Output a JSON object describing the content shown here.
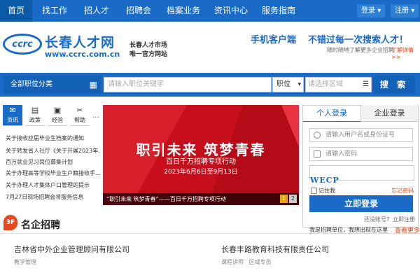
{
  "nav": {
    "items": [
      "首页",
      "找工作",
      "招人才",
      "招聘会",
      "档案业务",
      "资讯中心",
      "服务指南"
    ],
    "login": "登录",
    "register": "注册"
  },
  "header": {
    "logo_badge": "ccrc",
    "logo_name": "长春人才网",
    "logo_url": "www.ccrc.com.cn",
    "side_line1": "长春人才市场",
    "side_line2": "唯一官方网站",
    "slogan_mobile": "手机客户端",
    "slogan_main": "不错过每一次搜索人才！",
    "slogan_sub": "随时随地了解更多企业招聘",
    "learn_more": "了解详情>>"
  },
  "search": {
    "category_label": "全部职位分类",
    "placeholder": "请输入职位关键字",
    "type_selected": "职位",
    "region_placeholder": "请选择区域",
    "button_label": "搜 索"
  },
  "info_tabs": [
    "资讯",
    "政策",
    "经验",
    "帮助"
  ],
  "news": [
    "关于接收应届毕业生档案的通知",
    "关于转发省人社厅《关于开展2023年...",
    "百万就业见习岗位募集计划",
    "关于办理高等学校毕业生户籍接收手...",
    "关于办理人才集体户口管理的提示",
    "7月27日现场招聘会将服务信息"
  ],
  "banner": {
    "title": "职引未来 筑梦青春",
    "subtitle": "百日千万招聘专项行动",
    "date_range": "2023年6月6日至9月13日",
    "caption": "“职引未来 筑梦青春”——百日千万招聘专项行动",
    "pages": [
      "1",
      "2"
    ]
  },
  "login": {
    "tab_personal": "个人登录",
    "tab_company": "企业登录",
    "username_placeholder": "请输入用户名或身份证号",
    "password_placeholder": "请输入密码",
    "captcha": "WECP",
    "remember": "记住我",
    "forgot": "忘记密码",
    "submit": "立即登录",
    "no_account": "还没账号?",
    "register_now": "立即注册",
    "employer_tip": "我是招聘单位，我想出现在这里",
    "more": "查看更多"
  },
  "featured": {
    "badge": "3F",
    "title": "名企招聘",
    "companies": [
      {
        "name": "吉林省中外企业管理顾问有限公司",
        "jobs": "教学管理"
      },
      {
        "name": "长春丰路教育科技有限责任公司",
        "jobs": "课程讲师   区域专员"
      }
    ]
  },
  "colors": {
    "primary": "#1a6bc8",
    "banner": "#c70e1d",
    "accent": "#e8471d"
  }
}
